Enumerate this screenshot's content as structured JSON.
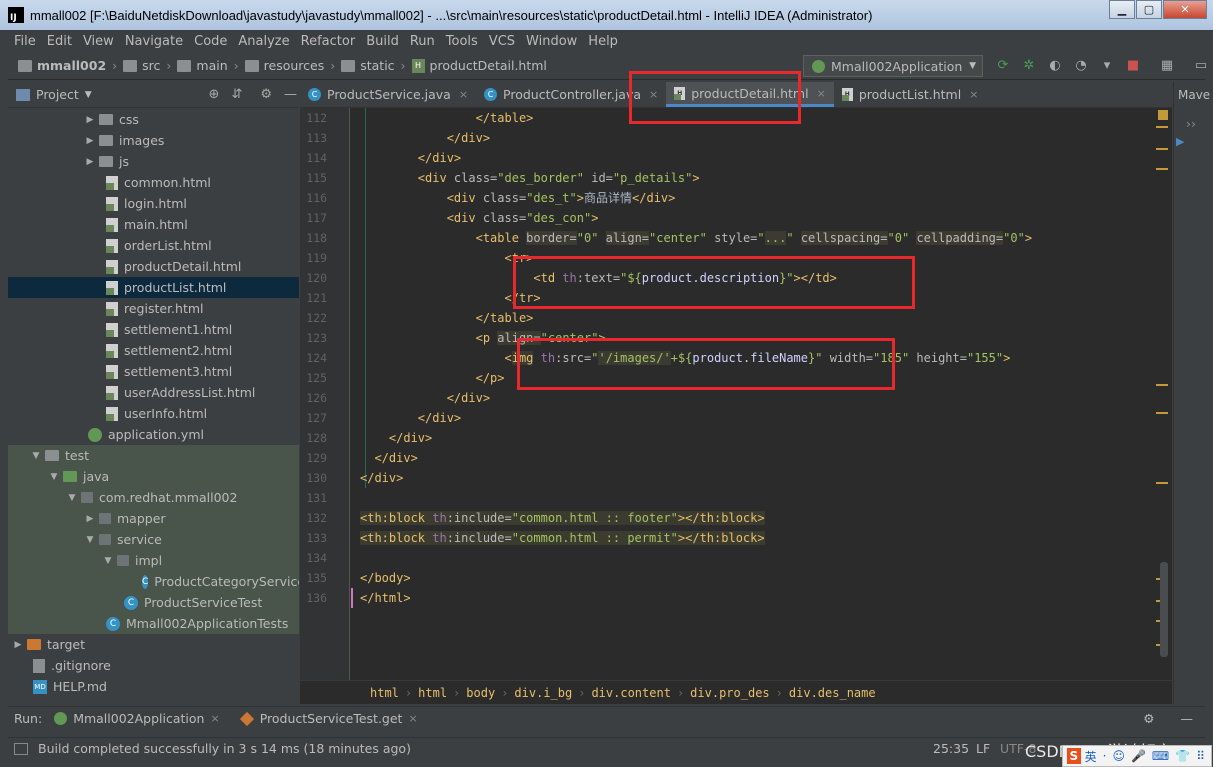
{
  "window": {
    "title": "mmall002 [F:\\BaiduNetdiskDownload\\javastudy\\javastudy\\mmall002] - ...\\src\\main\\resources\\static\\productDetail.html - IntelliJ IDEA (Administrator)",
    "app_icon": "IJ",
    "buttons": {
      "minimize": "▁",
      "maximize": "▢",
      "close": "✕"
    }
  },
  "menu": [
    "File",
    "Edit",
    "View",
    "Navigate",
    "Code",
    "Analyze",
    "Refactor",
    "Build",
    "Run",
    "Tools",
    "VCS",
    "Window",
    "Help"
  ],
  "breadcrumbs": [
    "mmall002",
    "src",
    "main",
    "resources",
    "static",
    "productDetail.html"
  ],
  "run_config": {
    "label": "Mmall002Application"
  },
  "project_panel": {
    "title": "Project",
    "tree": [
      {
        "label": "css",
        "type": "folder",
        "indent": 76,
        "arrow": "▶"
      },
      {
        "label": "images",
        "type": "folder",
        "indent": 76,
        "arrow": "▶"
      },
      {
        "label": "js",
        "type": "folder",
        "indent": 76,
        "arrow": "▶"
      },
      {
        "label": "common.html",
        "type": "html",
        "indent": 95
      },
      {
        "label": "login.html",
        "type": "html",
        "indent": 95
      },
      {
        "label": "main.html",
        "type": "html",
        "indent": 95
      },
      {
        "label": "orderList.html",
        "type": "html",
        "indent": 95
      },
      {
        "label": "productDetail.html",
        "type": "html",
        "indent": 95
      },
      {
        "label": "productList.html",
        "type": "html",
        "indent": 95,
        "selected": true
      },
      {
        "label": "register.html",
        "type": "html",
        "indent": 95
      },
      {
        "label": "settlement1.html",
        "type": "html",
        "indent": 95
      },
      {
        "label": "settlement2.html",
        "type": "html",
        "indent": 95
      },
      {
        "label": "settlement3.html",
        "type": "html",
        "indent": 95
      },
      {
        "label": "userAddressList.html",
        "type": "html",
        "indent": 95
      },
      {
        "label": "userInfo.html",
        "type": "html",
        "indent": 95
      },
      {
        "label": "application.yml",
        "type": "yml",
        "indent": 77
      },
      {
        "label": "test",
        "type": "folder",
        "indent": 22,
        "arrow": "▼",
        "test": true
      },
      {
        "label": "java",
        "type": "folder-green",
        "indent": 40,
        "arrow": "▼",
        "test": true
      },
      {
        "label": "com.redhat.mmall002",
        "type": "package",
        "indent": 58,
        "arrow": "▼",
        "test": true
      },
      {
        "label": "mapper",
        "type": "package",
        "indent": 76,
        "arrow": "▶",
        "test": true
      },
      {
        "label": "service",
        "type": "package",
        "indent": 76,
        "arrow": "▼",
        "test": true
      },
      {
        "label": "impl",
        "type": "package",
        "indent": 94,
        "arrow": "▼",
        "test": true
      },
      {
        "label": "ProductCategoryServiceI",
        "type": "class",
        "indent": 131,
        "test": true
      },
      {
        "label": "ProductServiceTest",
        "type": "class",
        "indent": 113,
        "test": true
      },
      {
        "label": "Mmall002ApplicationTests",
        "type": "class",
        "indent": 95,
        "test": true
      },
      {
        "label": "target",
        "type": "folder-orange",
        "indent": 4,
        "arrow": "▶"
      },
      {
        "label": ".gitignore",
        "type": "generic",
        "indent": 22
      },
      {
        "label": "HELP.md",
        "type": "md",
        "indent": 22
      }
    ]
  },
  "tabs": [
    {
      "label": "ProductService.java",
      "kind": "class"
    },
    {
      "label": "ProductController.java",
      "kind": "class"
    },
    {
      "label": "productDetail.html",
      "kind": "html",
      "active": true
    },
    {
      "label": "productList.html",
      "kind": "html"
    }
  ],
  "editor": {
    "line_numbers": [
      "112",
      "113",
      "114",
      "115",
      "116",
      "117",
      "118",
      "119",
      "120",
      "121",
      "122",
      "123",
      "124",
      "125",
      "126",
      "127",
      "128",
      "129",
      "130",
      "131",
      "132",
      "133",
      "134",
      "135",
      "136"
    ]
  },
  "code_crumbs": [
    "html",
    "html",
    "body",
    "div.i_bg",
    "div.content",
    "div.pro_des",
    "div.des_name"
  ],
  "maven": {
    "label": "Mave",
    "expand": "››"
  },
  "run_bar": {
    "label": "Run:",
    "tabs": [
      "Mmall002Application",
      "ProductServiceTest.get"
    ]
  },
  "status": {
    "message": "Build completed successfully in 3 s 14 ms (18 minutes ago)",
    "position": "25:35",
    "line_sep": "LF",
    "encoding": "UTF-8"
  },
  "watermark": "CSDN @一游鸿轩宸",
  "ime": {
    "lang": "英",
    "items": [
      "·",
      "☺",
      "🎤",
      "⌨",
      "👕",
      "⠿"
    ]
  }
}
